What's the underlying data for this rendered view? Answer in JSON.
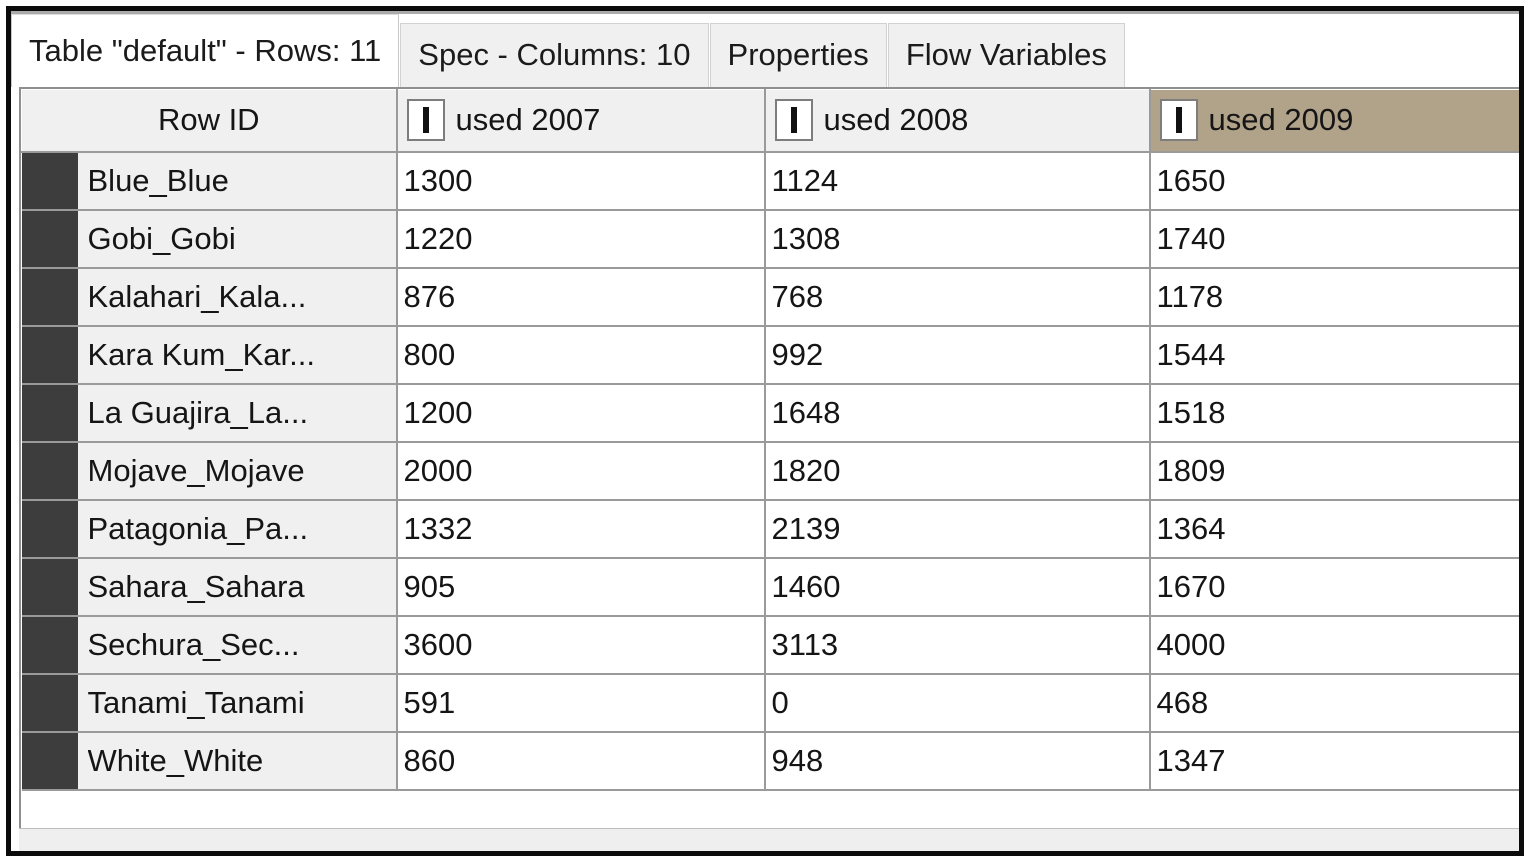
{
  "window": {
    "frame_color": "#0b0b0b",
    "background": "#ffffff"
  },
  "tabs": [
    {
      "label": "Table \"default\" - Rows: 11",
      "selected": true,
      "name": "tab-table-default"
    },
    {
      "label": "Spec - Columns: 10",
      "selected": false,
      "name": "tab-spec-columns"
    },
    {
      "label": "Properties",
      "selected": false,
      "name": "tab-properties"
    },
    {
      "label": "Flow Variables",
      "selected": false,
      "name": "tab-flow-variables"
    }
  ],
  "table": {
    "row_count": 11,
    "column_count_label": "10",
    "selected_column": "used 2009",
    "selected_header_color": "#b0a389",
    "rowid_cell_color": "#f0f0f0",
    "row_color_swatch": "#3d3d3d",
    "headers": {
      "rowid": "Row ID",
      "columns": [
        {
          "label": "used 2007",
          "type_icon": "integer-type-icon",
          "selected": false
        },
        {
          "label": "used 2008",
          "type_icon": "integer-type-icon",
          "selected": false
        },
        {
          "label": "used 2009",
          "type_icon": "integer-type-icon",
          "selected": true
        }
      ]
    },
    "rows": [
      {
        "rowid": "Blue_Blue",
        "v2007": "1300",
        "v2008": "1124",
        "v2009": "1650"
      },
      {
        "rowid": "Gobi_Gobi",
        "v2007": "1220",
        "v2008": "1308",
        "v2009": "1740"
      },
      {
        "rowid": "Kalahari_Kala...",
        "v2007": "876",
        "v2008": "768",
        "v2009": "1178"
      },
      {
        "rowid": "Kara Kum_Kar...",
        "v2007": "800",
        "v2008": "992",
        "v2009": "1544"
      },
      {
        "rowid": "La Guajira_La...",
        "v2007": "1200",
        "v2008": "1648",
        "v2009": "1518"
      },
      {
        "rowid": "Mojave_Mojave",
        "v2007": "2000",
        "v2008": "1820",
        "v2009": "1809"
      },
      {
        "rowid": "Patagonia_Pa...",
        "v2007": "1332",
        "v2008": "2139",
        "v2009": "1364"
      },
      {
        "rowid": "Sahara_Sahara",
        "v2007": "905",
        "v2008": "1460",
        "v2009": "1670"
      },
      {
        "rowid": "Sechura_Sec...",
        "v2007": "3600",
        "v2008": "3113",
        "v2009": "4000"
      },
      {
        "rowid": "Tanami_Tanami",
        "v2007": "591",
        "v2008": "0",
        "v2009": "468"
      },
      {
        "rowid": "White_White",
        "v2007": "860",
        "v2008": "948",
        "v2009": "1347"
      }
    ]
  }
}
